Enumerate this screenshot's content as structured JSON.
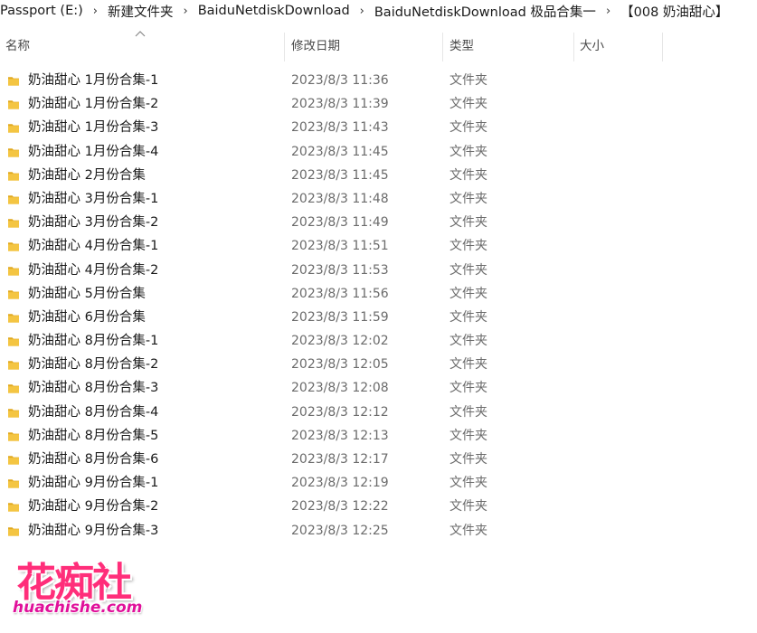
{
  "breadcrumb": [
    "Passport (E:)",
    "新建文件夹",
    "BaiduNetdiskDownload",
    "BaiduNetdiskDownload  极品合集一",
    "【008  奶油甜心】"
  ],
  "columns": {
    "name": "名称",
    "date": "修改日期",
    "type": "类型",
    "size": "大小"
  },
  "files": [
    {
      "name": "奶油甜心 1月份合集-1",
      "date": "2023/8/3 11:36",
      "type": "文件夹",
      "icon": "folder-icon"
    },
    {
      "name": "奶油甜心 1月份合集-2",
      "date": "2023/8/3 11:39",
      "type": "文件夹",
      "icon": "folder-icon"
    },
    {
      "name": "奶油甜心 1月份合集-3",
      "date": "2023/8/3 11:43",
      "type": "文件夹",
      "icon": "folder-icon"
    },
    {
      "name": "奶油甜心 1月份合集-4",
      "date": "2023/8/3 11:45",
      "type": "文件夹",
      "icon": "folder-icon"
    },
    {
      "name": "奶油甜心 2月份合集",
      "date": "2023/8/3 11:45",
      "type": "文件夹",
      "icon": "folder-icon"
    },
    {
      "name": "奶油甜心 3月份合集-1",
      "date": "2023/8/3 11:48",
      "type": "文件夹",
      "icon": "folder-icon"
    },
    {
      "name": "奶油甜心 3月份合集-2",
      "date": "2023/8/3 11:49",
      "type": "文件夹",
      "icon": "folder-icon"
    },
    {
      "name": "奶油甜心 4月份合集-1",
      "date": "2023/8/3 11:51",
      "type": "文件夹",
      "icon": "folder-icon"
    },
    {
      "name": "奶油甜心 4月份合集-2",
      "date": "2023/8/3 11:53",
      "type": "文件夹",
      "icon": "folder-icon"
    },
    {
      "name": "奶油甜心 5月份合集",
      "date": "2023/8/3 11:56",
      "type": "文件夹",
      "icon": "folder-icon"
    },
    {
      "name": "奶油甜心 6月份合集",
      "date": "2023/8/3 11:59",
      "type": "文件夹",
      "icon": "folder-icon"
    },
    {
      "name": "奶油甜心 8月份合集-1",
      "date": "2023/8/3 12:02",
      "type": "文件夹",
      "icon": "folder-icon"
    },
    {
      "name": "奶油甜心 8月份合集-2",
      "date": "2023/8/3 12:05",
      "type": "文件夹",
      "icon": "folder-icon"
    },
    {
      "name": "奶油甜心 8月份合集-3",
      "date": "2023/8/3 12:08",
      "type": "文件夹",
      "icon": "folder-icon"
    },
    {
      "name": "奶油甜心 8月份合集-4",
      "date": "2023/8/3 12:12",
      "type": "文件夹",
      "icon": "folder-icon"
    },
    {
      "name": "奶油甜心 8月份合集-5",
      "date": "2023/8/3 12:13",
      "type": "文件夹",
      "icon": "folder-icon"
    },
    {
      "name": "奶油甜心 8月份合集-6",
      "date": "2023/8/3 12:17",
      "type": "文件夹",
      "icon": "folder-icon"
    },
    {
      "name": "奶油甜心 9月份合集-1",
      "date": "2023/8/3 12:19",
      "type": "文件夹",
      "icon": "folder-icon"
    },
    {
      "name": "奶油甜心 9月份合集-2",
      "date": "2023/8/3 12:22",
      "type": "文件夹",
      "icon": "folder-icon"
    },
    {
      "name": "奶油甜心 9月份合集-3",
      "date": "2023/8/3 12:25",
      "type": "文件夹",
      "icon": "folder-icon"
    }
  ],
  "watermark": {
    "text_cn": "花痴社",
    "text_en": "huachishe.com"
  },
  "colors": {
    "folder": "#f4c542",
    "folder_dark": "#e1a91f",
    "logo_pink": "#ff2e7a"
  }
}
